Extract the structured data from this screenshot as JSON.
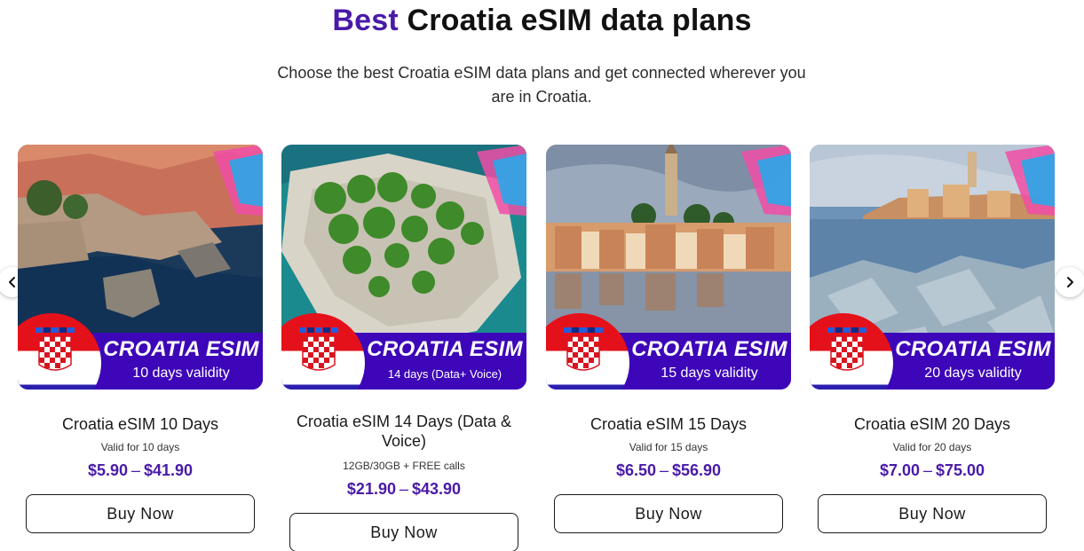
{
  "section": {
    "heading_accent": "Best",
    "heading_rest": "Croatia eSIM data plans",
    "subtitle": "Choose the best Croatia eSIM data plans and get connected wherever you are in Croatia."
  },
  "nav": {
    "prev_icon": "chevron-left-icon",
    "next_icon": "chevron-right-icon"
  },
  "brand": {
    "accent": "#4a1aa8",
    "banner": "#3d06b8"
  },
  "cards": [
    {
      "banner_title": "CROATIA ESIM",
      "banner_sub": "10 days validity",
      "title": "Croatia eSIM 10 Days",
      "desc": "Valid for 10 days",
      "price_from": "$5.90",
      "price_sep": "–",
      "price_to": "$41.90",
      "button": "Buy Now"
    },
    {
      "banner_title": "CROATIA ESIM",
      "banner_sub": "14 days (Data+ Voice)",
      "title": "Croatia eSIM 14 Days (Data & Voice)",
      "desc": "12GB/30GB + FREE calls",
      "price_from": "$21.90",
      "price_sep": "–",
      "price_to": "$43.90",
      "button": "Buy Now"
    },
    {
      "banner_title": "CROATIA ESIM",
      "banner_sub": "15 days validity",
      "title": "Croatia eSIM 15 Days",
      "desc": "Valid for 15 days",
      "price_from": "$6.50",
      "price_sep": "–",
      "price_to": "$56.90",
      "button": "Buy Now"
    },
    {
      "banner_title": "CROATIA ESIM",
      "banner_sub": "20 days validity",
      "title": "Croatia eSIM 20 Days",
      "desc": "Valid for 20 days",
      "price_from": "$7.00",
      "price_sep": "–",
      "price_to": "$75.00",
      "button": "Buy Now"
    }
  ]
}
